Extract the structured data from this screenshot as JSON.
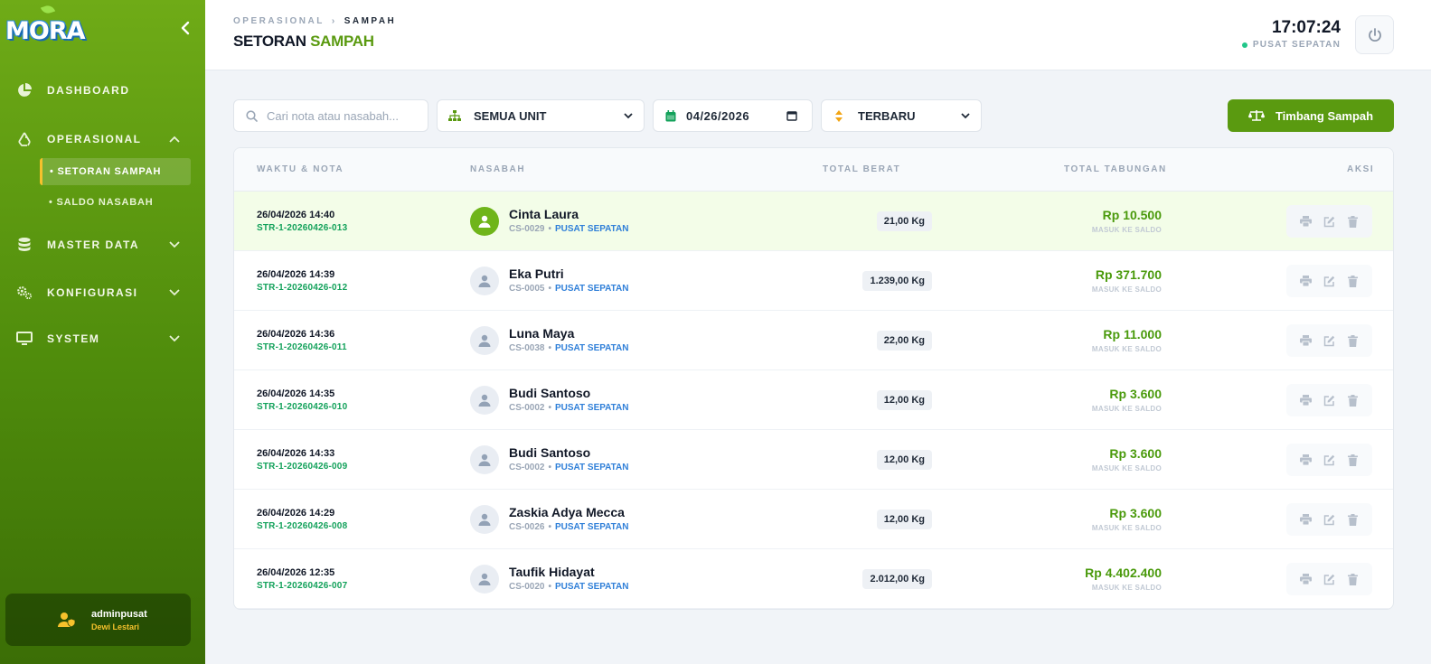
{
  "app": {
    "logo": "MORA"
  },
  "sidebar": {
    "items": [
      {
        "label": "DASHBOARD"
      },
      {
        "label": "OPERASIONAL"
      },
      {
        "label": "MASTER DATA"
      },
      {
        "label": "KONFIGURASI"
      },
      {
        "label": "SYSTEM"
      }
    ],
    "subitems": [
      {
        "label": "• SETORAN SAMPAH"
      },
      {
        "label": "• SALDO NASABAH"
      }
    ],
    "user": {
      "username": "adminpusat",
      "fullname": "Dewi Lestari"
    }
  },
  "header": {
    "breadcrumb_parent": "OPERASIONAL",
    "breadcrumb_sep": "›",
    "breadcrumb_current": "SAMPAH",
    "title_main": "SETORAN ",
    "title_accent": "SAMPAH",
    "clock": "17:07:24",
    "location": "PUSAT SEPATAN"
  },
  "filters": {
    "search_placeholder": "Cari nota atau nasabah...",
    "unit": "SEMUA UNIT",
    "date": "04/26/2026",
    "sort": "TERBARU",
    "timbang_label": "Timbang Sampah"
  },
  "table": {
    "headers": {
      "waktu": "WAKTU & NOTA",
      "nasabah": "NASABAH",
      "berat": "TOTAL BERAT",
      "tabungan": "TOTAL TABUNGAN",
      "aksi": "AKSI"
    },
    "rows": [
      {
        "time": "26/04/2026 14:40",
        "nota": "STR-1-20260426-013",
        "name": "Cinta Laura",
        "code": "CS-0029",
        "branch": "PUSAT SEPATAN",
        "berat": "21,00 Kg",
        "tabungan": "Rp 10.500",
        "note": "MASUK KE SALDO"
      },
      {
        "time": "26/04/2026 14:39",
        "nota": "STR-1-20260426-012",
        "name": "Eka Putri",
        "code": "CS-0005",
        "branch": "PUSAT SEPATAN",
        "berat": "1.239,00 Kg",
        "tabungan": "Rp 371.700",
        "note": "MASUK KE SALDO"
      },
      {
        "time": "26/04/2026 14:36",
        "nota": "STR-1-20260426-011",
        "name": "Luna Maya",
        "code": "CS-0038",
        "branch": "PUSAT SEPATAN",
        "berat": "22,00 Kg",
        "tabungan": "Rp 11.000",
        "note": "MASUK KE SALDO"
      },
      {
        "time": "26/04/2026 14:35",
        "nota": "STR-1-20260426-010",
        "name": "Budi Santoso",
        "code": "CS-0002",
        "branch": "PUSAT SEPATAN",
        "berat": "12,00 Kg",
        "tabungan": "Rp 3.600",
        "note": "MASUK KE SALDO"
      },
      {
        "time": "26/04/2026 14:33",
        "nota": "STR-1-20260426-009",
        "name": "Budi Santoso",
        "code": "CS-0002",
        "branch": "PUSAT SEPATAN",
        "berat": "12,00 Kg",
        "tabungan": "Rp 3.600",
        "note": "MASUK KE SALDO"
      },
      {
        "time": "26/04/2026 14:29",
        "nota": "STR-1-20260426-008",
        "name": "Zaskia Adya Mecca",
        "code": "CS-0026",
        "branch": "PUSAT SEPATAN",
        "berat": "12,00 Kg",
        "tabungan": "Rp 3.600",
        "note": "MASUK KE SALDO"
      },
      {
        "time": "26/04/2026 12:35",
        "nota": "STR-1-20260426-007",
        "name": "Taufik Hidayat",
        "code": "CS-0020",
        "branch": "PUSAT SEPATAN",
        "berat": "2.012,00 Kg",
        "tabungan": "Rp 4.402.400",
        "note": "MASUK KE SALDO"
      }
    ]
  },
  "colors": {
    "brand_green": "#5a9a10",
    "accent_yellow": "#f6c12c",
    "link_blue": "#2f7fd8",
    "nota_green": "#12a15a"
  }
}
